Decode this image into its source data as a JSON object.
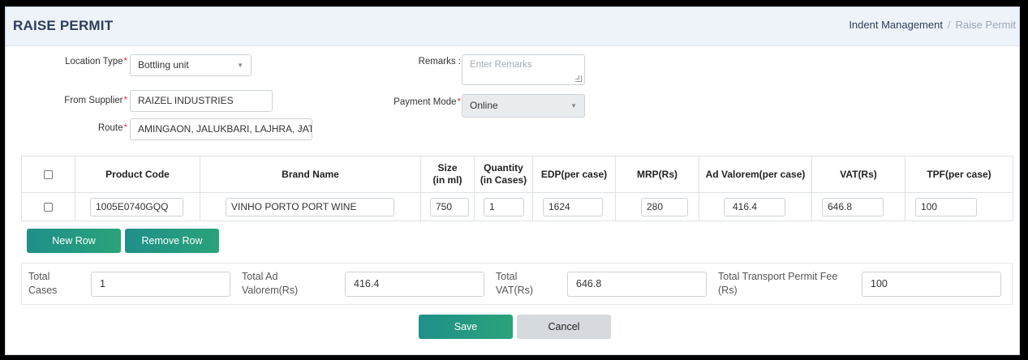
{
  "header": {
    "title": "RAISE PERMIT",
    "breadcrumb": [
      "Indent Management",
      "Raise Permit"
    ],
    "breadcrumb_sep": "/"
  },
  "form": {
    "location_type": {
      "label": "Location Type",
      "value": "Bottling unit",
      "required": true
    },
    "from_supplier": {
      "label": "From Supplier",
      "value": "RAIZEL INDUSTRIES",
      "required": true
    },
    "route": {
      "label": "Route",
      "value": "AMINGAON, JALUKBARI, LAJHRA, JATIA",
      "required": true
    },
    "remarks": {
      "label": "Remarks :",
      "placeholder": "Enter Remarks",
      "value": ""
    },
    "payment_mode": {
      "label": "Payment Mode",
      "value": "Online",
      "required": true
    }
  },
  "table": {
    "columns": [
      "Product Code",
      "Brand Name",
      "Size\n(in ml)",
      "Quantity\n(in Cases)",
      "EDP(per case)",
      "MRP(Rs)",
      "Ad Valorem(per case)",
      "VAT(Rs)",
      "TPF(per case)"
    ],
    "rows": [
      {
        "product_code": "1005E0740GQQ",
        "brand_name": "VINHO PORTO PORT WINE",
        "size": "750",
        "quantity": "1",
        "edp": "1624",
        "mrp": "280",
        "ad_valorem": "416.4",
        "vat": "646.8",
        "tpf": "100"
      }
    ]
  },
  "buttons": {
    "new_row": "New Row",
    "remove_row": "Remove Row",
    "save": "Save",
    "cancel": "Cancel"
  },
  "totals": {
    "cases": {
      "label": "Total Cases",
      "value": "1"
    },
    "ad_valorem": {
      "label": "Total Ad Valorem(Rs)",
      "value": "416.4"
    },
    "vat": {
      "label": "Total VAT(Rs)",
      "value": "646.8"
    },
    "tpf": {
      "label": "Total Transport Permit Fee (Rs)",
      "value": "100"
    }
  },
  "colors": {
    "accent": "#1f8f8a",
    "title": "#2c3e5c",
    "required": "#e53935"
  },
  "icons": {
    "dropdown": "chevron-down-icon",
    "resize": "resize-grip-icon"
  }
}
